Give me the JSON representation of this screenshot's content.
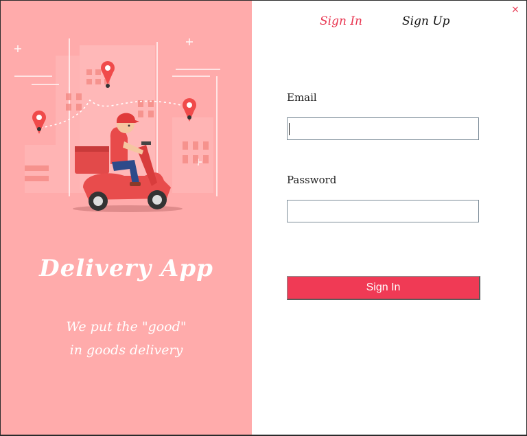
{
  "left_panel": {
    "app_name": "Delivery App",
    "tagline_line1": "We put the \"good\"",
    "tagline_line2": "in goods delivery",
    "illustration_icon": "delivery-scooter-illustration"
  },
  "tabs": {
    "sign_in": "Sign In",
    "sign_up": "Sign Up",
    "active": "sign_in"
  },
  "window": {
    "close_glyph": "×"
  },
  "form": {
    "email_label": "Email",
    "email_value": "",
    "password_label": "Password",
    "password_value": "",
    "submit_label": "Sign In"
  },
  "colors": {
    "left_panel_bg": "#ffabab",
    "accent": "#f03a55",
    "active_tab": "#e8344f"
  }
}
